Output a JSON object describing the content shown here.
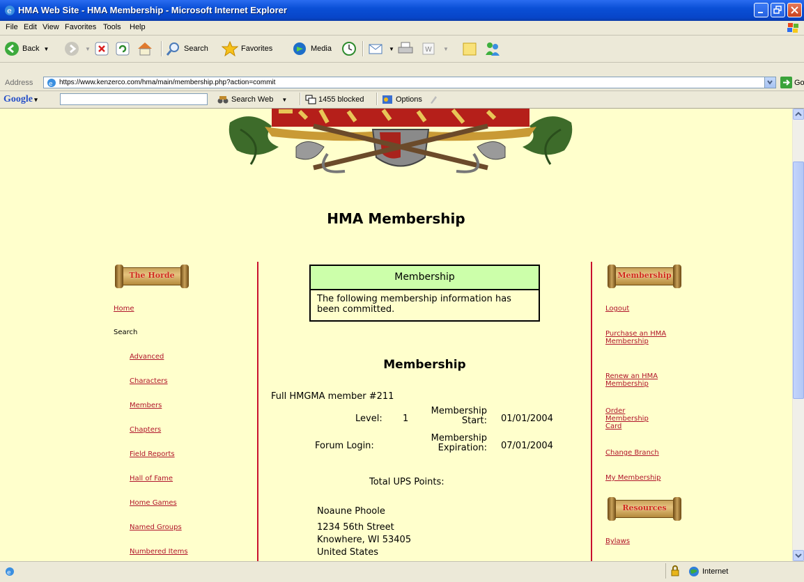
{
  "window": {
    "title": "HMA Web Site - HMA Membership - Microsoft Internet Explorer"
  },
  "menu": [
    "File",
    "Edit",
    "View",
    "Favorites",
    "Tools",
    "Help"
  ],
  "toolbar": {
    "back": "Back",
    "search": "Search",
    "favorites": "Favorites",
    "media": "Media"
  },
  "address": {
    "label": "Address",
    "url": "https://www.kenzerco.com/hma/main/membership.php?action=commit",
    "go": "Go"
  },
  "googlebar": {
    "logo": "Google",
    "search_web": "Search Web",
    "blocked": "1455 blocked",
    "options": "Options"
  },
  "page": {
    "title": "HMA Membership"
  },
  "left_nav": {
    "banner": "The Horde",
    "items": [
      {
        "label": "Home",
        "link": true
      },
      {
        "label": "Search",
        "link": false
      },
      {
        "label": "Advanced",
        "link": true
      },
      {
        "label": "Characters",
        "link": true
      },
      {
        "label": "Members",
        "link": true
      },
      {
        "label": "Chapters",
        "link": true
      },
      {
        "label": "Field Reports",
        "link": true
      },
      {
        "label": "Hall of Fame",
        "link": true
      },
      {
        "label": "Home Games",
        "link": true
      },
      {
        "label": "Named Groups",
        "link": true
      },
      {
        "label": "Numbered Items",
        "link": true
      }
    ]
  },
  "notice": {
    "heading": "Membership",
    "message": "The following membership information has been committed."
  },
  "membership": {
    "heading": "Membership",
    "member_line": "Full HMGMA member #211",
    "level_label": "Level:",
    "level_value": "1",
    "start_label_1": "Membership",
    "start_label_2": "Start:",
    "start_value": "01/01/2004",
    "forum_label": "Forum Login:",
    "exp_label_1": "Membership",
    "exp_label_2": "Expiration:",
    "exp_value": "07/01/2004",
    "ups_label": "Total UPS Points:",
    "address": [
      "Noaune Phoole",
      "1234 56th Street",
      "Knowhere, WI 53405",
      "United States"
    ]
  },
  "right_nav": {
    "banner": "Membership",
    "items": [
      "Logout",
      "Purchase an HMA Membership",
      "Renew an HMA Membership",
      "Order Membership Card",
      "Change Branch",
      "My Membership"
    ],
    "resources_banner": "Resources",
    "resources_items": [
      "Bylaws"
    ]
  },
  "status": {
    "zone": "Internet"
  }
}
